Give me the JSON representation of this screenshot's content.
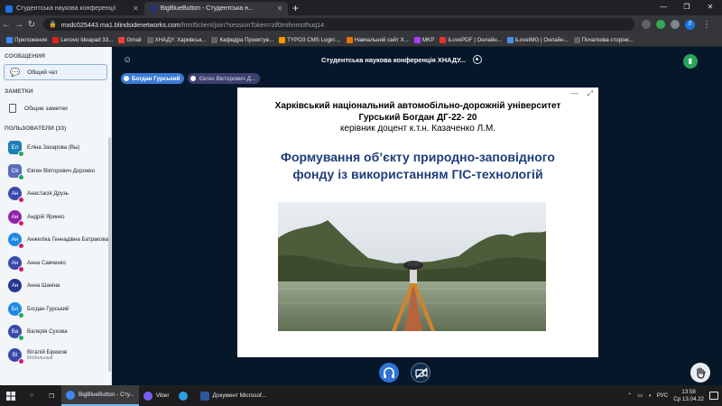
{
  "browser": {
    "tabs": [
      {
        "label": "Студентська наукова конференції",
        "favicon_color": "#1a73e8",
        "active": false
      },
      {
        "label": "BigBlueButton - Студентська н...",
        "favicon_color": "#283274",
        "active": true
      }
    ],
    "url_host": "mxdc025443.ma1.blindsidenetworks.com",
    "url_path": "/html5client/join?sessionToken=zif0mihnmcthuq14",
    "profile_initial": "Л",
    "bookmarks": [
      {
        "label": "Приложения",
        "color": "#4285f4"
      },
      {
        "label": "Lenovo Ideapad 33...",
        "color": "#e2231a"
      },
      {
        "label": "Gmail",
        "color": "#ea4335"
      },
      {
        "label": "ХНАДУ: Харківськ...",
        "color": "#5f6368"
      },
      {
        "label": "Кафедра Проектув...",
        "color": "#5f6368"
      },
      {
        "label": "TYPO3 CMS Login:...",
        "color": "#f49700"
      },
      {
        "label": "Навчальний сайт Х...",
        "color": "#e37400"
      },
      {
        "label": "MKP",
        "color": "#a142f4"
      },
      {
        "label": "iLovePDF | Онлайн...",
        "color": "#e5322d"
      },
      {
        "label": "iLoveIMG | Онлайн...",
        "color": "#4d8ff0"
      },
      {
        "label": "Початкова сторінк...",
        "color": "#5f6368"
      }
    ]
  },
  "sidebar": {
    "messages_title": "СООБЩЕНИЯ",
    "public_chat": "Общий чат",
    "notes_title": "ЗАМЕТКИ",
    "shared_notes": "Общие заметки",
    "users_title": "ПОЛЬЗОВАТЕЛИ (33)",
    "users": [
      {
        "initials": "Ел",
        "name": "Еліна Захарова (Вы)",
        "color": "#1e7fb8",
        "shape": "square",
        "badge": "#26a65b"
      },
      {
        "initials": "Св",
        "name": "Євген Вікторович Дорожко",
        "color": "#5c6bc0",
        "shape": "square",
        "badge": "#26a65b"
      },
      {
        "initials": "Ан",
        "name": "Анастасія Друзь",
        "color": "#3949ab",
        "shape": "round",
        "badge": "#d81b60"
      },
      {
        "initials": "Ан",
        "name": "Андрій Яринко",
        "color": "#8e24aa",
        "shape": "round",
        "badge": "#d81b60"
      },
      {
        "initials": "Ан",
        "name": "Анжеліка Геннадівна Батракова",
        "color": "#1e88e5",
        "shape": "round",
        "badge": "#d81b60"
      },
      {
        "initials": "Ан",
        "name": "Анна Савченко",
        "color": "#3949ab",
        "shape": "round",
        "badge": "#d81b60"
      },
      {
        "initials": "Ан",
        "name": "Анна Шаніна",
        "color": "#283593",
        "shape": "round",
        "badge": ""
      },
      {
        "initials": "Бо",
        "name": "Богдан Гурський",
        "color": "#1e88e5",
        "shape": "round",
        "badge": "#26a65b"
      },
      {
        "initials": "Ва",
        "name": "Валерія Сухова",
        "color": "#3949ab",
        "shape": "round",
        "badge": "#26a65b"
      },
      {
        "initials": "Ві",
        "name": "Віталій Бірюков",
        "sub": "Мобильный",
        "color": "#3949ab",
        "shape": "round",
        "badge": "#d81b60"
      }
    ]
  },
  "main": {
    "meeting_title": "Студентська наукова конференція ХНАДУ...",
    "talkers": [
      "Богдан Гурський",
      "Євген Вікторович Д..."
    ],
    "slide": {
      "university": "Харківський національний автомобільно-дорожній університет",
      "author": "Гурський Богдан ДГ-22- 20",
      "advisor": "керівник доцент к.т.н. Казаченко Л.М.",
      "topic_line1": "Формування об’єкту природно-заповідного",
      "topic_line2": "фонду із використанням ГІС-технологій"
    }
  },
  "taskbar": {
    "search_icon": "search-icon",
    "apps": [
      {
        "label": "BigBlueButton - Сту...",
        "color": "#4285f4",
        "active": true
      },
      {
        "label": "Viber",
        "color": "#7360f2",
        "active": false
      },
      {
        "label": "",
        "color": "#2aa3df",
        "active": false
      },
      {
        "label": "Документ Microsof...",
        "color": "#2b579a",
        "active": false
      }
    ],
    "lang": "РУС",
    "time": "13:58",
    "date": "Ср 13.04.22"
  }
}
